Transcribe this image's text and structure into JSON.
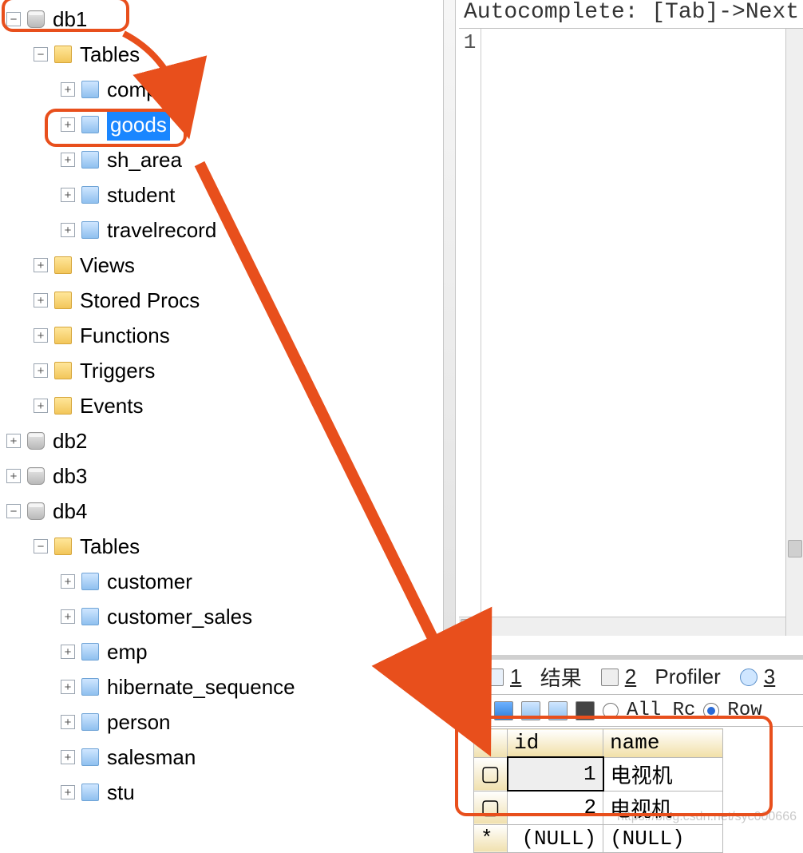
{
  "editor": {
    "hint": "Autocomplete: [Tab]->Next Ta",
    "line_number": "1"
  },
  "tree": {
    "db1": {
      "label": "db1",
      "tables_label": "Tables",
      "tables": [
        "company",
        "goods",
        "sh_area",
        "student",
        "travelrecord"
      ],
      "folders": [
        "Views",
        "Stored Procs",
        "Functions",
        "Triggers",
        "Events"
      ],
      "selected_table": "goods"
    },
    "db2": {
      "label": "db2"
    },
    "db3": {
      "label": "db3"
    },
    "db4": {
      "label": "db4",
      "tables_label": "Tables",
      "tables": [
        "customer",
        "customer_sales",
        "emp",
        "hibernate_sequence",
        "person",
        "salesman",
        "stu"
      ]
    }
  },
  "results": {
    "tabs": {
      "t1_key": "1",
      "t1_label": "结果",
      "t2_key": "2",
      "t2_label": "Profiler",
      "t3_key": "3"
    },
    "toolbar": {
      "all_label": "All Rc",
      "row_label": "Row"
    },
    "columns": [
      "id",
      "name"
    ],
    "rows": [
      {
        "id": "1",
        "name": "电视机"
      },
      {
        "id": "2",
        "name": "电视机"
      },
      {
        "id": "(NULL)",
        "name": "(NULL)"
      }
    ]
  },
  "watermark": "https://blog.csdn.net/syc000666"
}
